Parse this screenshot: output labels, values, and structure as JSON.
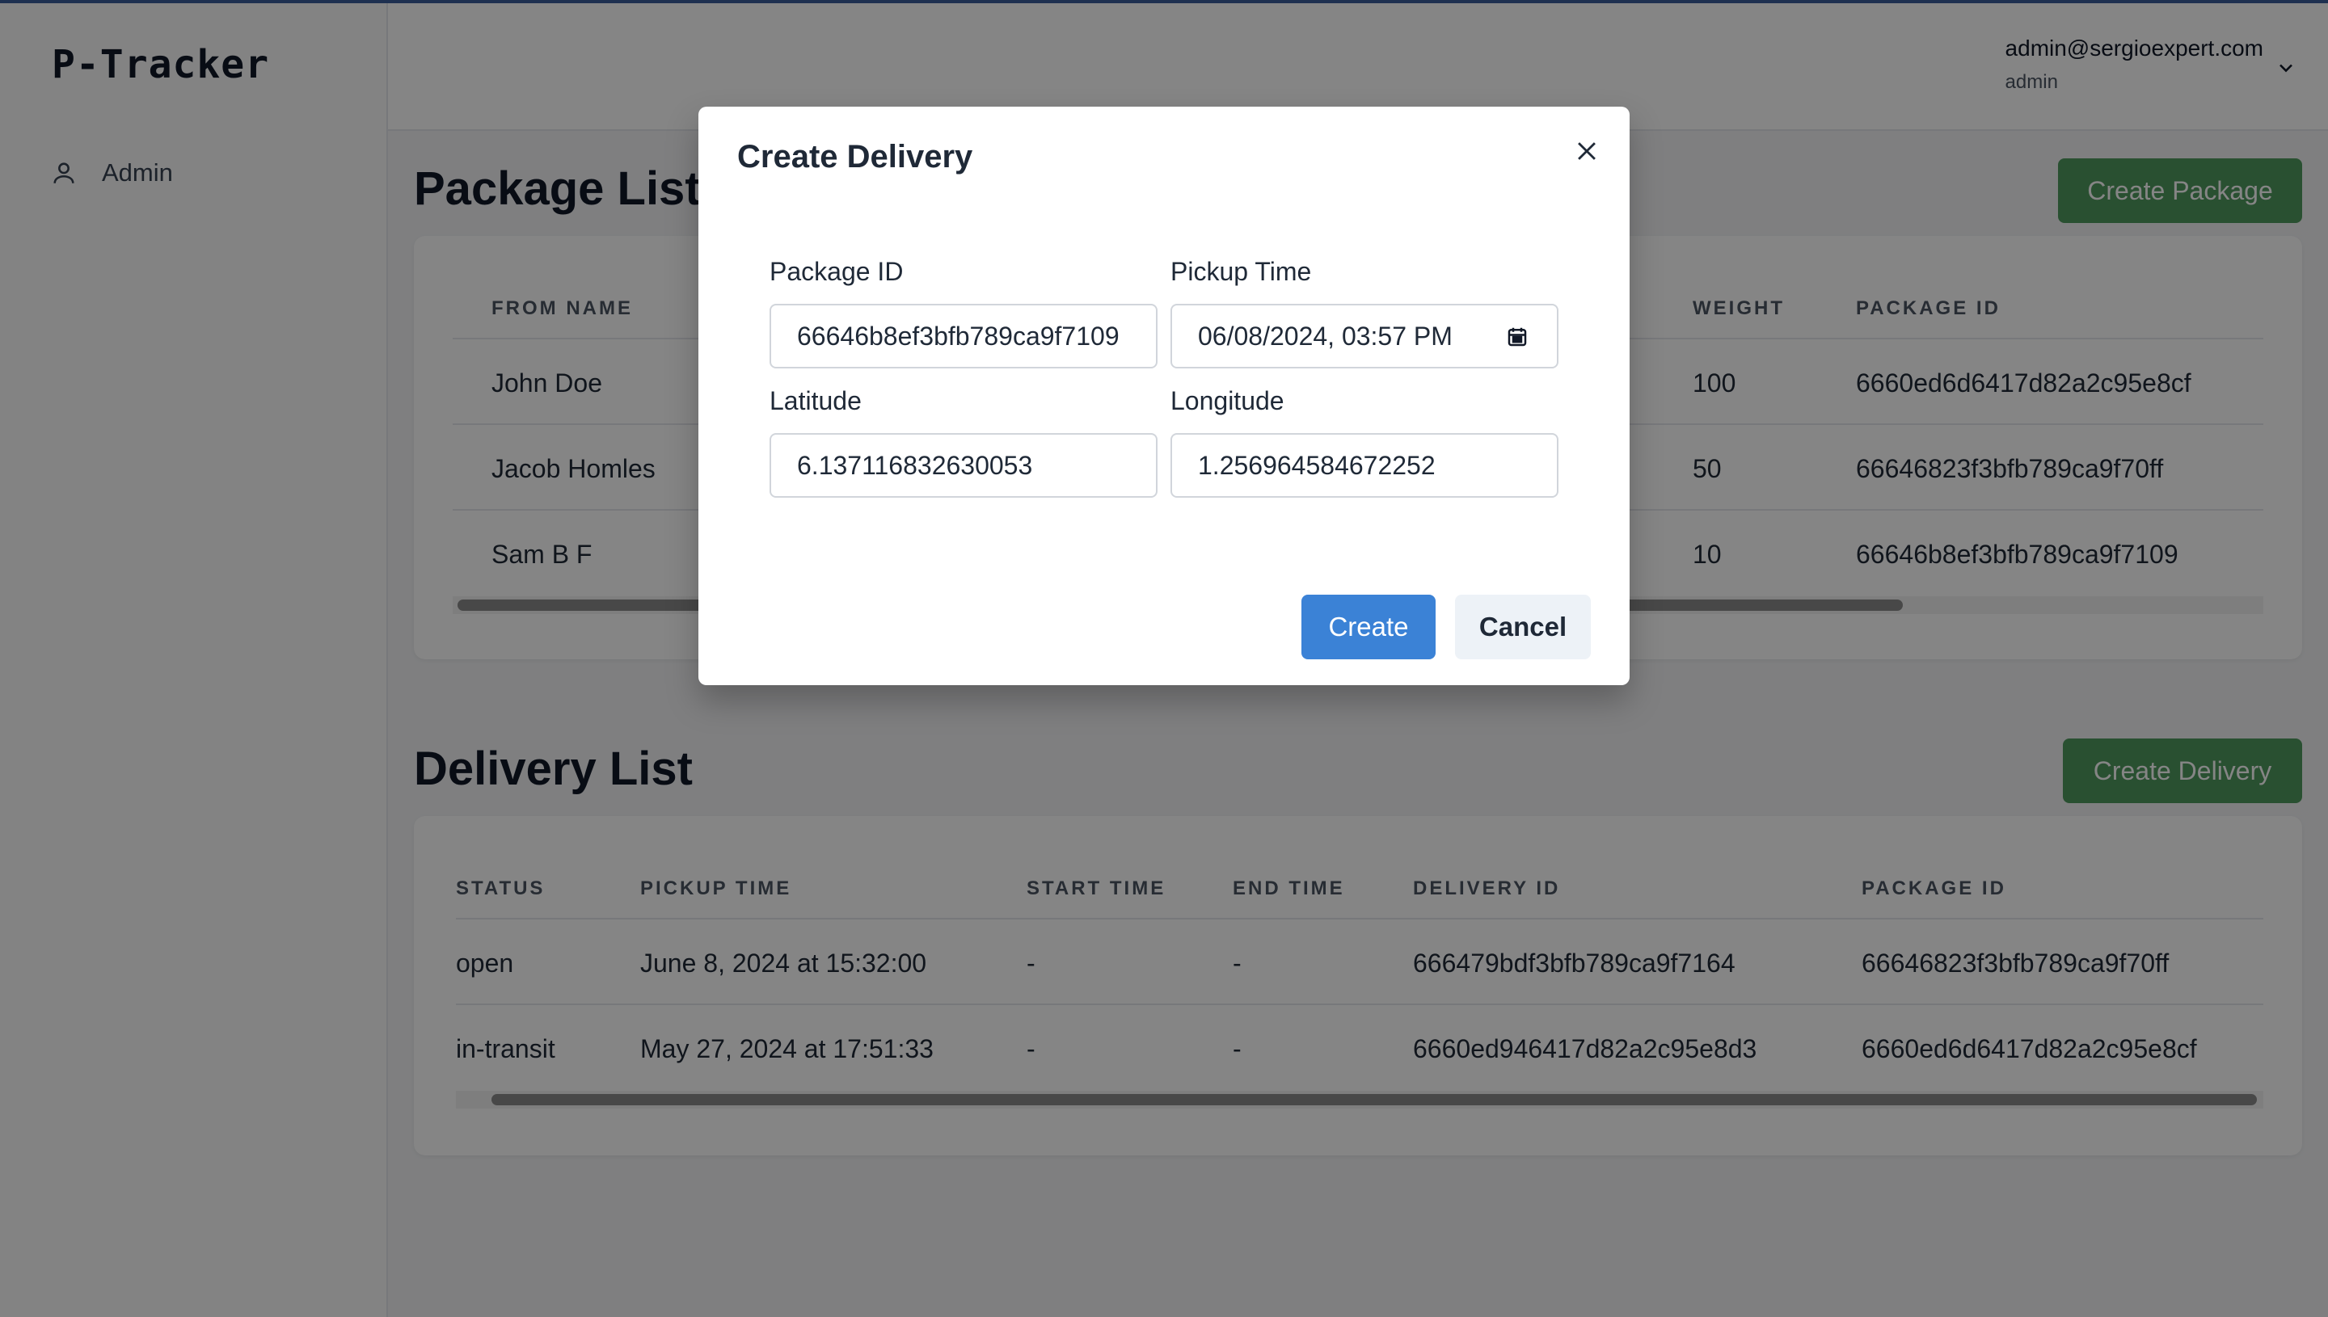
{
  "app": {
    "logo": "P-Tracker"
  },
  "sidebar": {
    "items": [
      {
        "label": "Admin",
        "icon": "user-icon"
      }
    ]
  },
  "header": {
    "email": "admin@sergioexpert.com",
    "role": "admin"
  },
  "package_section": {
    "title": "Package List",
    "create_button": "Create Package",
    "columns": [
      "FROM NAME",
      "WEIGHT",
      "PACKAGE ID"
    ],
    "rows": [
      {
        "from_name": "John Doe",
        "weight": "100",
        "package_id": "6660ed6d6417d82a2c95e8cf"
      },
      {
        "from_name": "Jacob Homles",
        "weight": "50",
        "package_id": "66646823f3bfb789ca9f70ff"
      },
      {
        "from_name": "Sam B F",
        "weight": "10",
        "package_id": "66646b8ef3bfb789ca9f7109"
      }
    ]
  },
  "delivery_section": {
    "title": "Delivery List",
    "create_button": "Create Delivery",
    "columns": [
      "STATUS",
      "PICKUP TIME",
      "START TIME",
      "END TIME",
      "DELIVERY ID",
      "PACKAGE ID"
    ],
    "rows": [
      {
        "status": "open",
        "pickup_time": "June 8, 2024 at 15:32:00",
        "start_time": "-",
        "end_time": "-",
        "delivery_id": "666479bdf3bfb789ca9f7164",
        "package_id": "66646823f3bfb789ca9f70ff"
      },
      {
        "status": "in-transit",
        "pickup_time": "May 27, 2024 at 17:51:33",
        "start_time": "-",
        "end_time": "-",
        "delivery_id": "6660ed946417d82a2c95e8d3",
        "package_id": "6660ed6d6417d82a2c95e8cf"
      }
    ]
  },
  "modal": {
    "title": "Create Delivery",
    "fields": {
      "package_id": {
        "label": "Package ID",
        "value": "66646b8ef3bfb789ca9f7109"
      },
      "pickup_time": {
        "label": "Pickup Time",
        "value": "06/08/2024, 03:57 PM"
      },
      "latitude": {
        "label": "Latitude",
        "value": "6.137116832630053"
      },
      "longitude": {
        "label": "Longitude",
        "value": "1.256964584672252"
      }
    },
    "create_button": "Create",
    "cancel_button": "Cancel"
  },
  "colors": {
    "accent_blue": "#3b82d6",
    "brand_green": "#4f9a5e",
    "top_line": "#3b5d9a"
  }
}
